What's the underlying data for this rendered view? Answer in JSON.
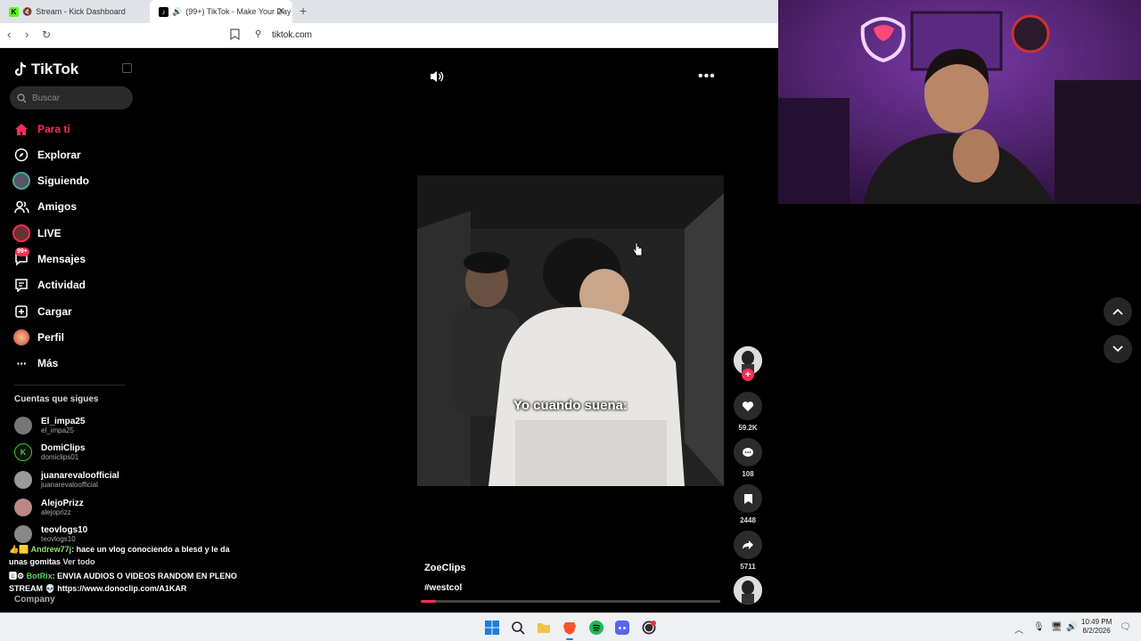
{
  "browser": {
    "tabs": [
      {
        "title": "Stream - Kick Dashboard",
        "favicon": "K"
      },
      {
        "title": "(99+) TikTok - Make Your Day",
        "favicon": "♪"
      }
    ],
    "url": "tiktok.com"
  },
  "sidebar": {
    "logo": "TikTok",
    "search_placeholder": "Buscar",
    "menu": [
      {
        "label": "Para ti",
        "icon": "home-icon",
        "active": true
      },
      {
        "label": "Explorar",
        "icon": "compass-icon"
      },
      {
        "label": "Siguiendo",
        "icon": "following-icon"
      },
      {
        "label": "Amigos",
        "icon": "friends-icon"
      },
      {
        "label": "LIVE",
        "icon": "live-icon"
      },
      {
        "label": "Mensajes",
        "icon": "messages-icon",
        "badge": "99+"
      },
      {
        "label": "Actividad",
        "icon": "activity-icon"
      },
      {
        "label": "Cargar",
        "icon": "upload-icon"
      },
      {
        "label": "Perfil",
        "icon": "profile-icon"
      },
      {
        "label": "Más",
        "icon": "more-icon"
      }
    ],
    "following_title": "Cuentas que sigues",
    "accounts": [
      {
        "name": "El_impa25",
        "handle": "el_impa25"
      },
      {
        "name": "DomiClips",
        "handle": "domiclips01"
      },
      {
        "name": "juanarevaloofficial",
        "handle": "juanarevaloofficial"
      },
      {
        "name": "AlejoPrizz",
        "handle": "alejoprizz"
      },
      {
        "name": "teovlogs10",
        "handle": "teovlogs10"
      }
    ],
    "ver_todo": "Ver todo",
    "company": "Company"
  },
  "chat": [
    {
      "user": "Andrew77j",
      "text": ": hace un vlog conociendo a blesd y le da unas gomitas"
    },
    {
      "user": "BotRix",
      "text": ": ENVIA AUDIOS O VIDEOS RANDOM EN PLENO STREAM 💀 https://www.donoclip.com/A1KAR"
    }
  ],
  "video": {
    "caption": "Yo cuando suena:",
    "author": "ZoeClips",
    "hashtag": "#westcol",
    "progress": 0.05
  },
  "actions": {
    "likes": "59.2K",
    "comments": "108",
    "saves": "2448",
    "shares": "5711"
  },
  "taskbar": {
    "time": "10:49 PM",
    "date": "8/2/2026"
  },
  "colors": {
    "accent": "#fe2c55",
    "background": "#000000"
  }
}
